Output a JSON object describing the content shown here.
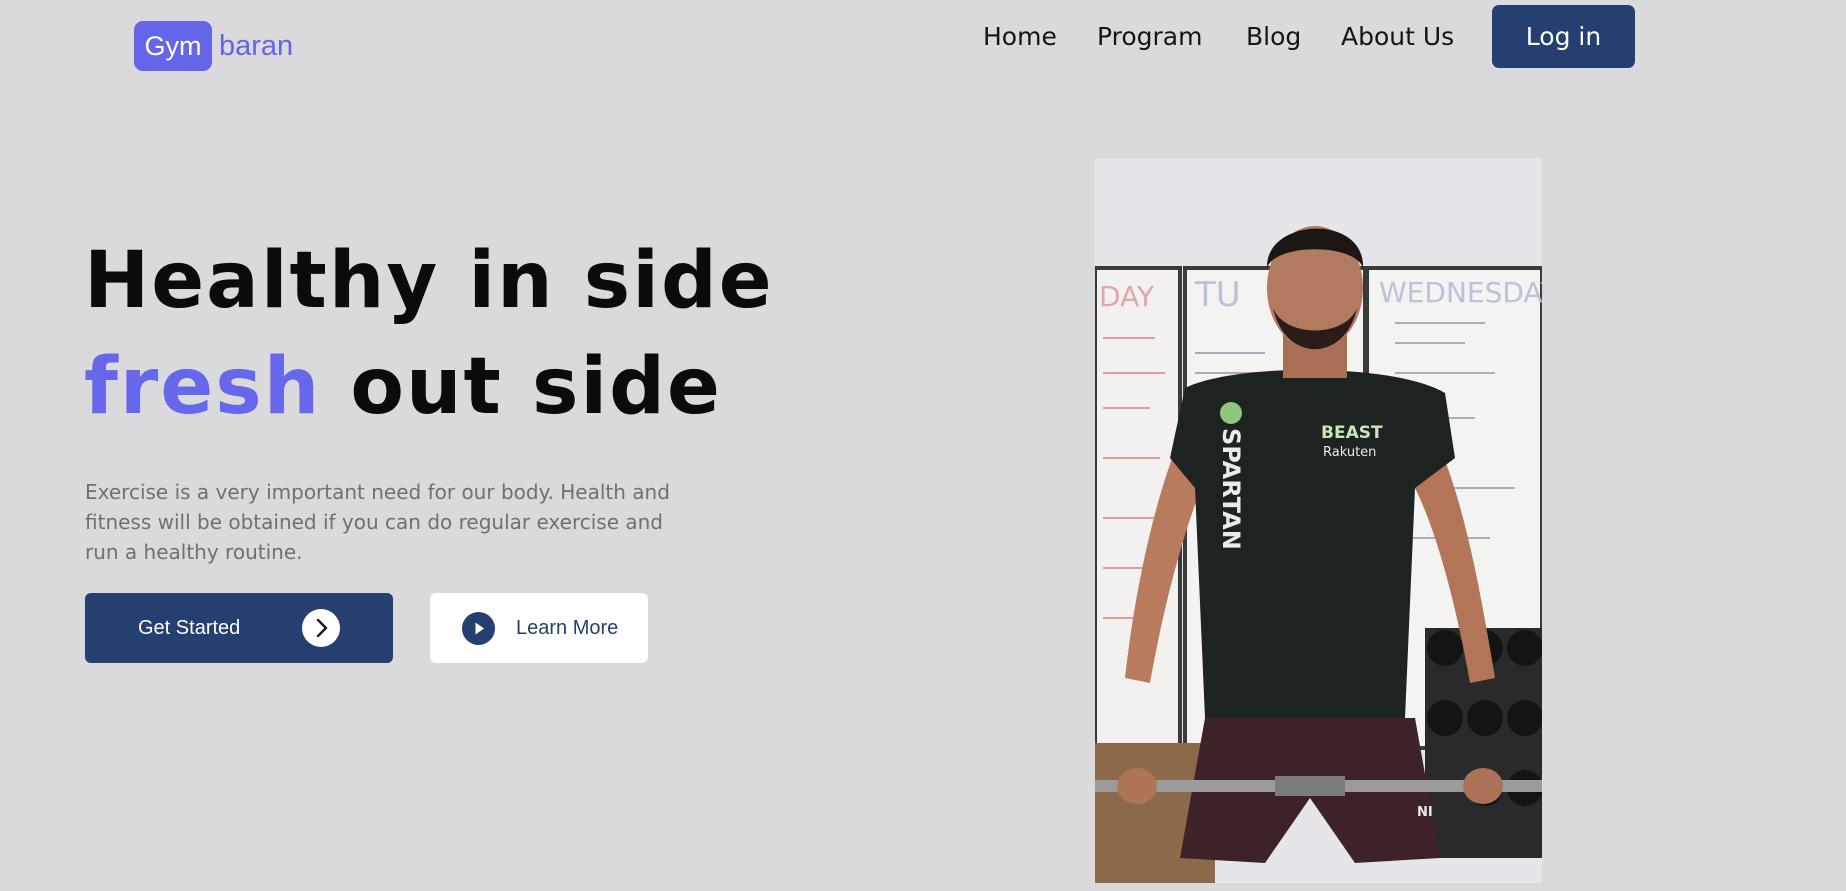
{
  "logo": {
    "box_text": "Gym",
    "text": "baran"
  },
  "nav": {
    "items": [
      {
        "label": "Home"
      },
      {
        "label": "Program"
      },
      {
        "label": "Blog"
      },
      {
        "label": "About Us"
      }
    ],
    "login_label": "Log in"
  },
  "hero": {
    "title_line1": "Healthy in side",
    "title_accent": "fresh",
    "title_line2_rest": " out side",
    "description": "Exercise is a very important need for our body. Health and fitness will be obtained if you can do regular exercise and run a healthy routine.",
    "get_started_label": "Get Started",
    "learn_more_label": "Learn More"
  },
  "photo": {
    "board_headings": [
      "DAY",
      "TU",
      "WEDNESDAY"
    ],
    "shirt_text": [
      "SPARTAN",
      "BEAST",
      "Rakuten"
    ],
    "shorts_text": "NI"
  },
  "colors": {
    "background": "#dadadc",
    "accent": "#6465e8",
    "primary": "#243f70",
    "text_dark": "#0b0b0b",
    "text_muted": "#707072"
  }
}
